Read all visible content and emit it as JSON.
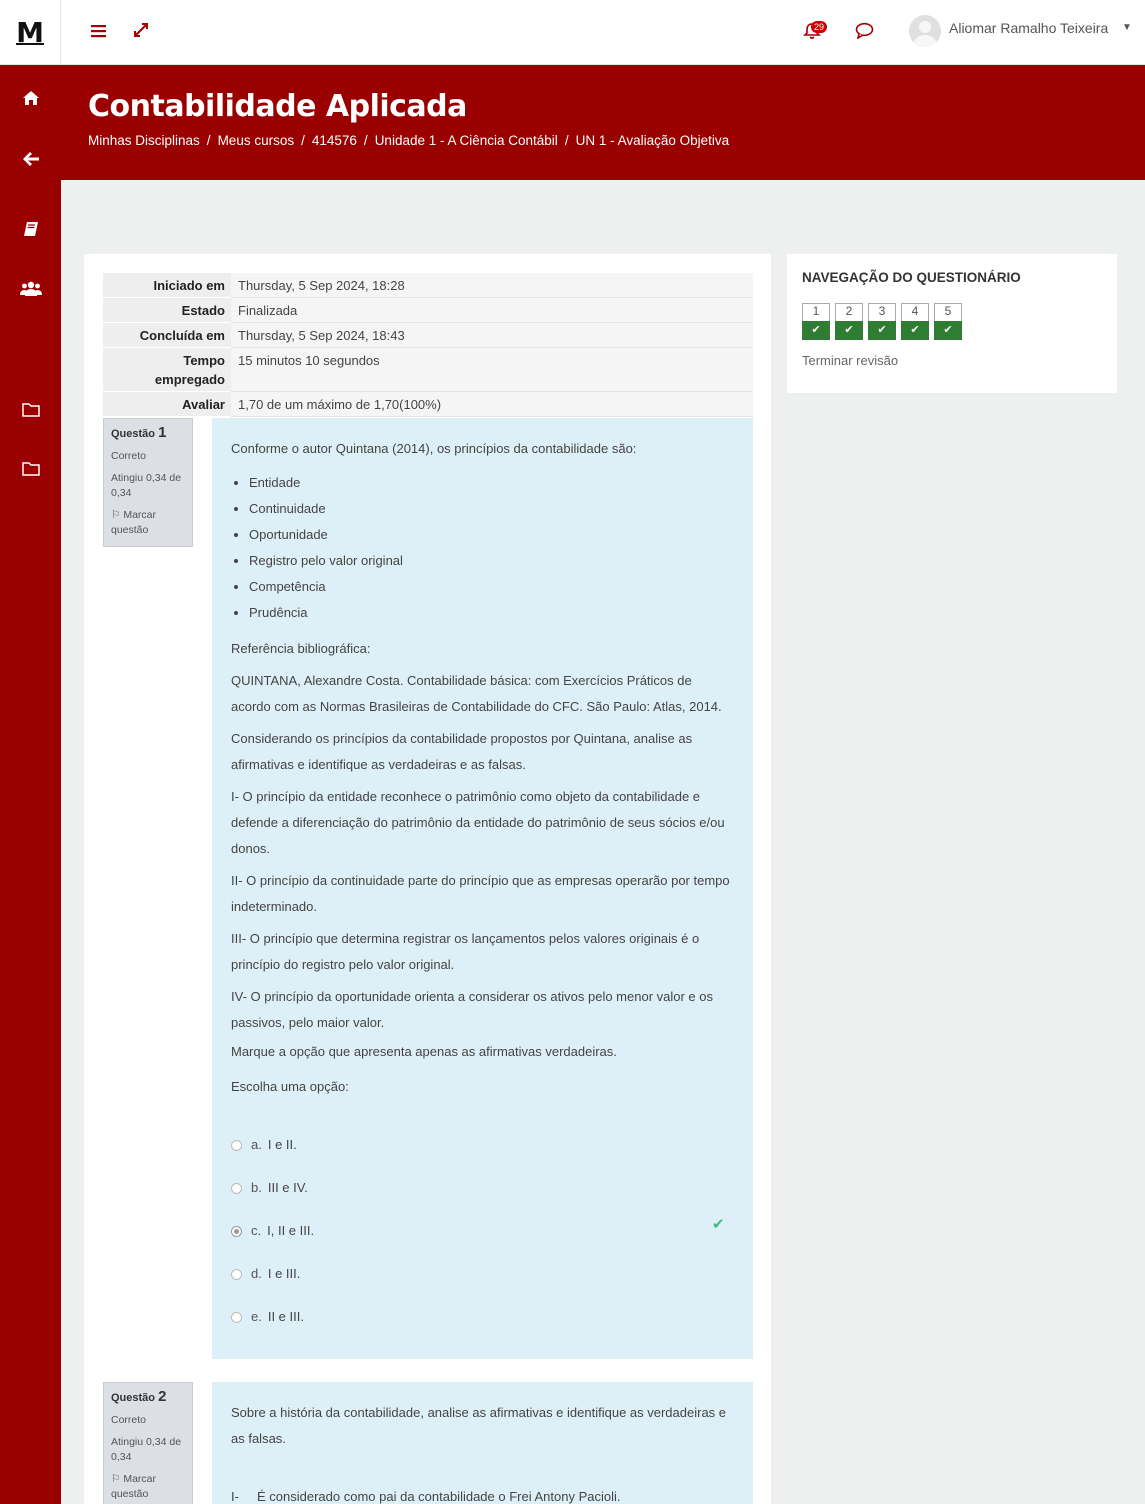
{
  "topbar": {
    "logo": "M",
    "notification_count": "29",
    "user_name": "Aliomar Ramalho Teixeira"
  },
  "sidebar": {
    "items": [
      "home-icon",
      "back-icon",
      "book-icon",
      "users-icon",
      "folder-icon",
      "folder-icon"
    ]
  },
  "header": {
    "title": "Contabilidade Aplicada",
    "breadcrumb": [
      "Minhas Disciplinas",
      "Meus cursos",
      "414576",
      "Unidade 1 - A Ciência Contábil",
      "UN 1 - Avaliação Objetiva"
    ]
  },
  "summary": {
    "rows": [
      {
        "label": "Iniciado em",
        "value": "Thursday, 5 Sep 2024, 18:28"
      },
      {
        "label": "Estado",
        "value": "Finalizada"
      },
      {
        "label": "Concluída em",
        "value": "Thursday, 5 Sep 2024, 18:43"
      },
      {
        "label": "Tempo empregado",
        "value": "15 minutos 10 segundos"
      },
      {
        "label": "Avaliar",
        "value": "1,70 de um máximo de 1,70(100%)"
      }
    ]
  },
  "questions": [
    {
      "label": "Questão",
      "number": "1",
      "state": "Correto",
      "grade": "Atingiu 0,34 de 0,34",
      "flag": "Marcar questão",
      "intro": "Conforme o autor Quintana (2014), os princípios da contabilidade são:",
      "principles": [
        "Entidade",
        "Continuidade",
        "Oportunidade",
        "Registro pelo valor original",
        "Competência",
        "Prudência"
      ],
      "ref_title": "Referência bibliográfica:",
      "ref_text": "QUINTANA, Alexandre Costa. Contabilidade básica: com Exercícios Práticos de acordo com as Normas Brasileiras de Contabilidade do CFC. São Paulo: Atlas, 2014.",
      "prompt": "Considerando os princípios da contabilidade propostos por Quintana, analise as afirmativas e identifique as verdadeiras e as falsas.",
      "statements": [
        "I- O princípio da entidade reconhece o patrimônio como objeto da contabilidade e defende a diferenciação do patrimônio da entidade do patrimônio de seus sócios e/ou donos.",
        "II- O princípio da continuidade parte do princípio que as empresas operarão por tempo indeterminado.",
        "III- O princípio que determina registrar os lançamentos pelos valores originais é o princípio do registro pelo valor original.",
        "IV- O princípio da oportunidade orienta a considerar os ativos pelo menor valor e os passivos, pelo maior valor."
      ],
      "instruction": "Marque a opção que apresenta apenas as afirmativas verdadeiras.",
      "choose": "Escolha uma opção:",
      "options": [
        {
          "letter": "a.",
          "text": "I e II."
        },
        {
          "letter": "b.",
          "text": "III e IV."
        },
        {
          "letter": "c.",
          "text": "I, II e III."
        },
        {
          "letter": "d.",
          "text": "I e III."
        },
        {
          "letter": "e.",
          "text": "II e III."
        }
      ],
      "selected": "c."
    },
    {
      "label": "Questão",
      "number": "2",
      "state": "Correto",
      "grade": "Atingiu 0,34 de 0,34",
      "flag": "Marcar questão",
      "intro": "Sobre a história da contabilidade, analise as afirmativas e identifique as verdadeiras e as falsas.",
      "statement_num": "I-",
      "statement_text": "É considerado como pai da contabilidade o Frei Antony Pacioli."
    }
  ],
  "quiz_nav": {
    "title": "NAVEGAÇÃO DO QUESTIONÁRIO",
    "buttons": [
      "1",
      "2",
      "3",
      "4",
      "5"
    ],
    "finish": "Terminar revisão"
  },
  "colors": {
    "brand": "#9b0000",
    "correct": "#2f7d32",
    "question_bg": "#def0f7"
  }
}
